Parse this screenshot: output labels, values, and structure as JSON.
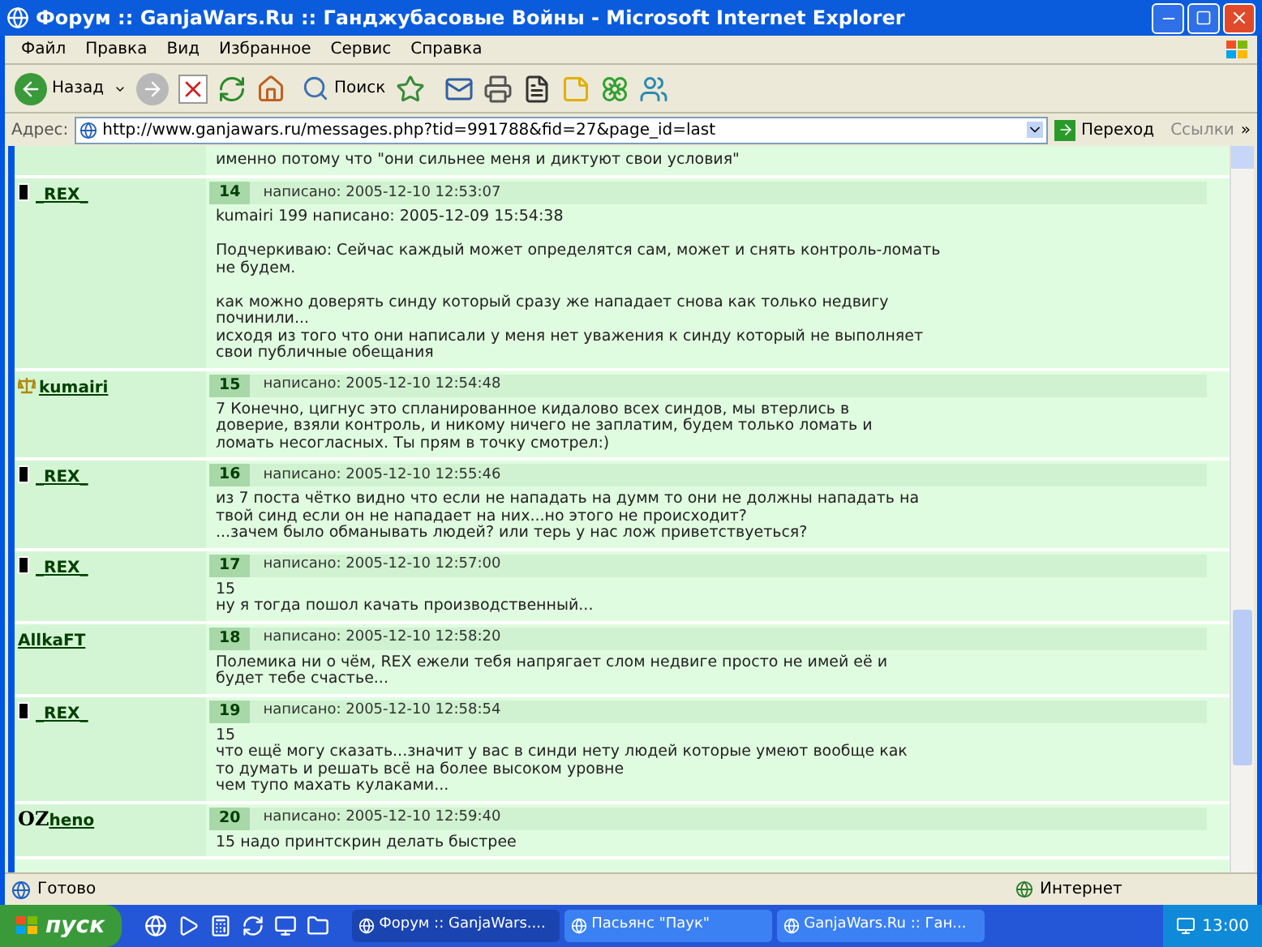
{
  "window": {
    "title": "Форум :: GanjaWars.Ru :: Ганджубасовые Войны - Microsoft Internet Explorer"
  },
  "menu": [
    "Файл",
    "Правка",
    "Вид",
    "Избранное",
    "Сервис",
    "Справка"
  ],
  "toolbar": {
    "back": "Назад",
    "search": "Поиск"
  },
  "address_bar": {
    "label": "Адрес:",
    "url": "http://www.ganjawars.ru/messages.php?tid=991788&fid=27&page_id=last",
    "go": "Переход",
    "links": "Ссылки",
    "more": "»"
  },
  "previous_post_tail": "именно потому что \"они сильнее меня и диктуют свои условия\"",
  "posts": [
    {
      "author": "_REX_",
      "badge": {
        "kind": "phone"
      },
      "number": "14",
      "posted": "написано: 2005-12-10 12:53:07",
      "paragraphs": [
        [
          "kumairi 199 написано: 2005-12-09 15:54:38"
        ],
        [
          "Подчеркиваю: Сейчас каждый может определятся сам, может и снять контроль-ломать",
          "не будем."
        ],
        [
          "как можно доверять синду который сразу же нападает снова как только недвигу",
          "починили...",
          "исходя из того что они написали у меня нет уважения к синду который не выполняет",
          "свои публичные обещания"
        ]
      ]
    },
    {
      "author": "kumairi",
      "badge": {
        "kind": "scales"
      },
      "number": "15",
      "posted": "написано: 2005-12-10 12:54:48",
      "paragraphs": [
        [
          "7 Конечно, цигнус это спланированное кидалово всех синдов, мы втерлись в",
          "доверие, взяли контроль, и никому ничего не заплатим, будем только ломать и",
          "ломать несогласных. Ты прям в точку смотрел:)"
        ]
      ]
    },
    {
      "author": "_REX_",
      "badge": {
        "kind": "phone"
      },
      "number": "16",
      "posted": "написано: 2005-12-10 12:55:46",
      "paragraphs": [
        [
          "из 7 поста чётко видно что если не нападать на думм то они не должны нападать на",
          "твой синд если он не нападает на них...но этого не происходит?",
          "...зачем было обманывать людей? или терь у нас лож приветствуеться?"
        ]
      ]
    },
    {
      "author": "_REX_",
      "badge": {
        "kind": "phone"
      },
      "number": "17",
      "posted": "написано: 2005-12-10 12:57:00",
      "paragraphs": [
        [
          "15",
          "ну я тогда пошол качать производственный..."
        ]
      ]
    },
    {
      "author": "AllkaFT",
      "number": "18",
      "posted": "написано: 2005-12-10 12:58:20",
      "paragraphs": [
        [
          "Полемика ни о чём, REX ежели тебя напрягает слом недвиге просто не имей её и",
          "будет тебе счастье..."
        ]
      ]
    },
    {
      "author": "_REX_",
      "badge": {
        "kind": "phone"
      },
      "number": "19",
      "posted": "написано: 2005-12-10 12:58:54",
      "paragraphs": [
        [
          "15",
          "что ещё могу сказать...значит у вас в синди нету людей которые умеют вообще как",
          "то думать и решать всё на более высоком уровне",
          "чем тупо махать кулаками..."
        ]
      ]
    },
    {
      "author": "heno",
      "badge": {
        "kind": "logo",
        "text": "OZ"
      },
      "number": "20",
      "posted": "написано: 2005-12-10 12:59:40",
      "paragraphs": [
        [
          "15 надо принтскрин делать быстрее"
        ]
      ]
    }
  ],
  "status_bar": {
    "text": "Готово",
    "zone": "Интернет"
  },
  "taskbar": {
    "start": "пуск",
    "tasks": [
      {
        "label": "Форум :: GanjaWars....",
        "selected": true
      },
      {
        "label": "Пасьянс \"Паук\"",
        "selected": false
      },
      {
        "label": "GanjaWars.Ru :: Ган...",
        "selected": false
      }
    ],
    "clock": "13:00"
  }
}
